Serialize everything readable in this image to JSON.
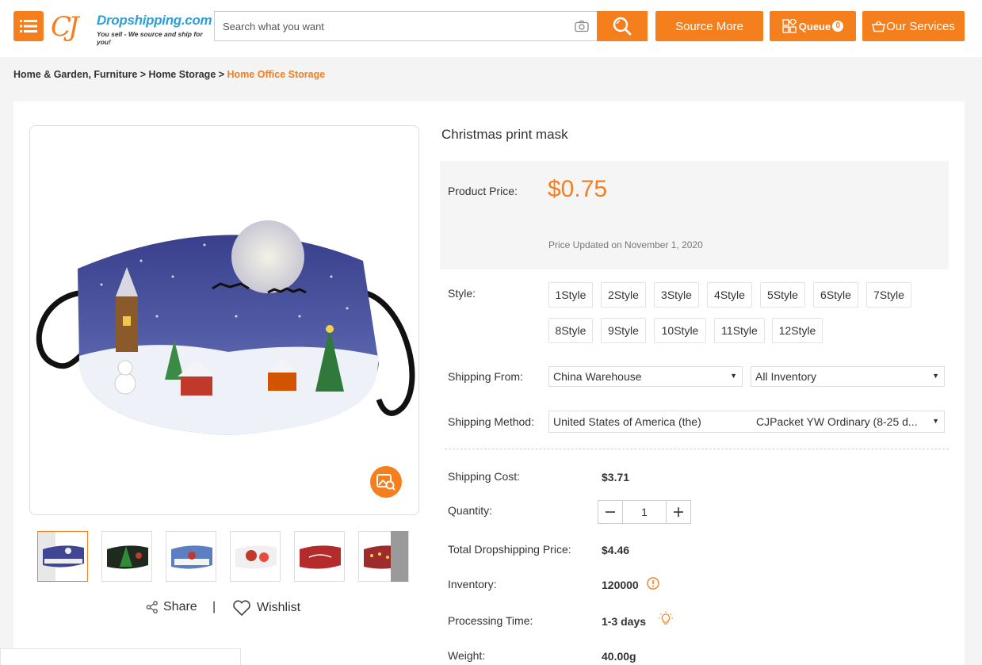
{
  "header": {
    "logo_cj": "CJ",
    "logo_name": "Dropshipping.com",
    "logo_tagline": "You sell - We source and ship for you!",
    "search_placeholder": "Search what you want",
    "source_more": "Source More",
    "queue_label": "Queue",
    "queue_count": "0",
    "services_label": "Our Services"
  },
  "breadcrumb": {
    "part1": "Home & Garden, Furniture",
    "sep": " > ",
    "part2": "Home Storage",
    "current": "Home Office Storage"
  },
  "product": {
    "title": "Christmas print mask",
    "price_label": "Product Price:",
    "price": "$0.75",
    "price_updated": "Price Updated on November 1, 2020",
    "style_label": "Style:",
    "styles": [
      "1Style",
      "2Style",
      "3Style",
      "4Style",
      "5Style",
      "6Style",
      "7Style",
      "8Style",
      "9Style",
      "10Style",
      "11Style",
      "12Style"
    ],
    "shipping_from_label": "Shipping From:",
    "shipping_from": "China Warehouse",
    "inventory_filter": "All Inventory",
    "shipping_method_label": "Shipping Method:",
    "shipping_country": "United States of America (the)",
    "shipping_method": "CJPacket YW Ordinary (8-25 d...",
    "shipping_cost_label": "Shipping Cost:",
    "shipping_cost": "$3.71",
    "quantity_label": "Quantity:",
    "quantity": "1",
    "total_label": "Total Dropshipping Price:",
    "total": "$4.46",
    "inventory_label": "Inventory:",
    "inventory": "120000",
    "processing_label": "Processing Time:",
    "processing": "1-3 days",
    "weight_label": "Weight:",
    "weight": "40.00g"
  },
  "actions": {
    "share": "Share",
    "divider": "|",
    "wishlist": "Wishlist"
  },
  "colors": {
    "accent": "#f57e1d",
    "logo_blue": "#2a9fd8"
  }
}
